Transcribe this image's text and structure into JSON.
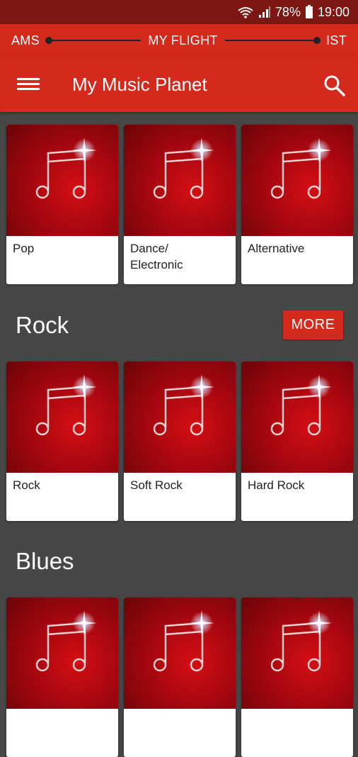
{
  "status": {
    "battery": "78%",
    "time": "19:00"
  },
  "flight": {
    "origin": "AMS",
    "label": "MY FLIGHT",
    "destination": "IST"
  },
  "toolbar": {
    "title": "My Music Planet"
  },
  "top_genres": [
    {
      "label": "Pop"
    },
    {
      "label": "Dance/\nElectronic"
    },
    {
      "label": "Alternative"
    }
  ],
  "rock": {
    "title": "Rock",
    "more_label": "MORE",
    "items": [
      {
        "label": "Rock"
      },
      {
        "label": "Soft Rock"
      },
      {
        "label": "Hard Rock"
      }
    ]
  },
  "blues": {
    "title": "Blues"
  }
}
